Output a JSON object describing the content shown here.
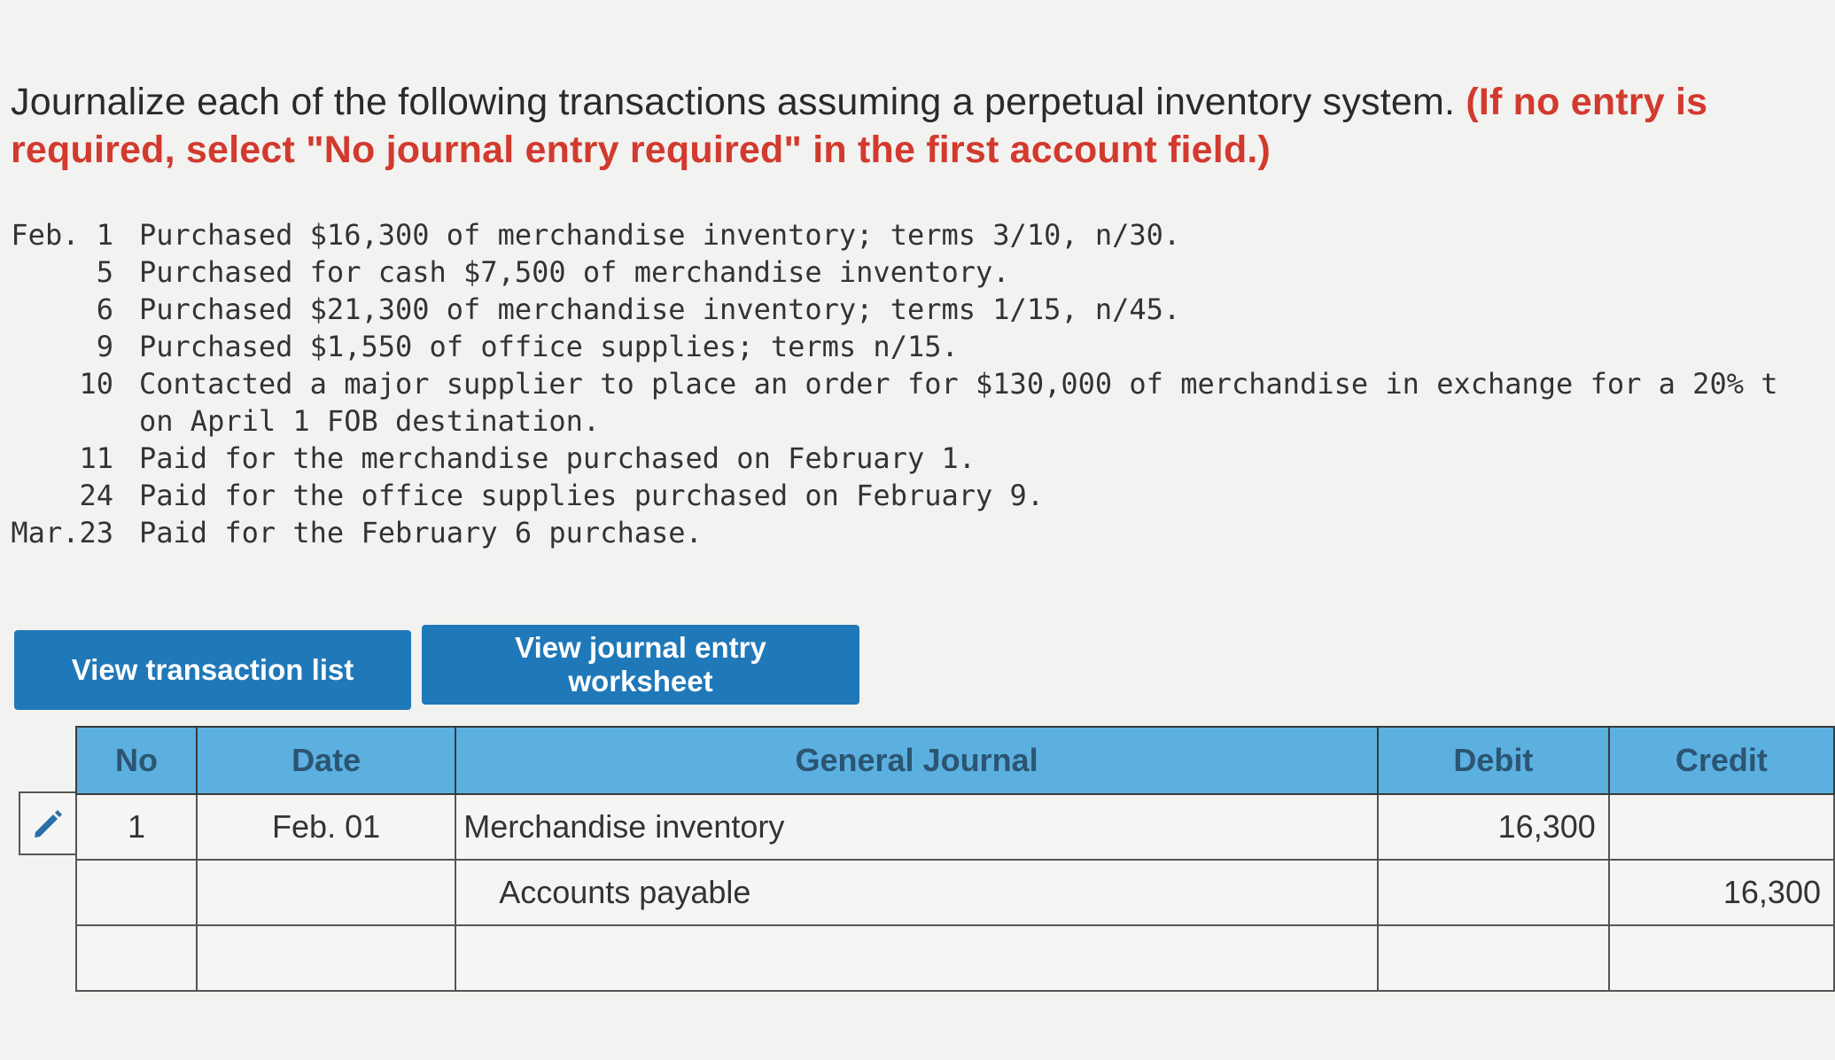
{
  "instructions": {
    "text": "Journalize each of the following transactions assuming a perpetual inventory system. ",
    "required_note": "(If no entry is required, select \"No journal entry required\" in the first account field.)"
  },
  "transactions": [
    {
      "date": "Feb. 1",
      "text": "Purchased $16,300 of merchandise inventory; terms 3/10, n/30."
    },
    {
      "date": "5",
      "text": "Purchased for cash $7,500 of merchandise inventory."
    },
    {
      "date": "6",
      "text": "Purchased $21,300 of merchandise inventory; terms 1/15, n/45."
    },
    {
      "date": "9",
      "text": "Purchased $1,550 of office supplies; terms n/15."
    },
    {
      "date": "10",
      "text": "Contacted a major supplier to place an order for $130,000 of merchandise in exchange for a 20% t"
    },
    {
      "date": "",
      "text": "on April 1 FOB destination."
    },
    {
      "date": "11",
      "text": "Paid for the merchandise purchased on February 1."
    },
    {
      "date": "24",
      "text": "Paid for the office supplies purchased on February 9."
    },
    {
      "date": "Mar.23",
      "text": "Paid for the February 6 purchase."
    }
  ],
  "buttons": {
    "transaction_list": "View transaction list",
    "journal_worksheet": "View journal entry worksheet"
  },
  "journal": {
    "headers": {
      "no": "No",
      "date": "Date",
      "general_journal": "General Journal",
      "debit": "Debit",
      "credit": "Credit"
    },
    "rows": [
      {
        "no": "1",
        "date": "Feb. 01",
        "account": "Merchandise inventory",
        "debit": "16,300",
        "credit": ""
      },
      {
        "no": "",
        "date": "",
        "account": "Accounts payable",
        "debit": "",
        "credit": "16,300"
      },
      {
        "no": "",
        "date": "",
        "account": "",
        "debit": "",
        "credit": ""
      }
    ]
  },
  "icons": {
    "edit": "pencil-icon"
  },
  "colors": {
    "accent_blue": "#1f78b8",
    "header_blue": "#5bb0e0",
    "required_red": "#d23a2e"
  }
}
